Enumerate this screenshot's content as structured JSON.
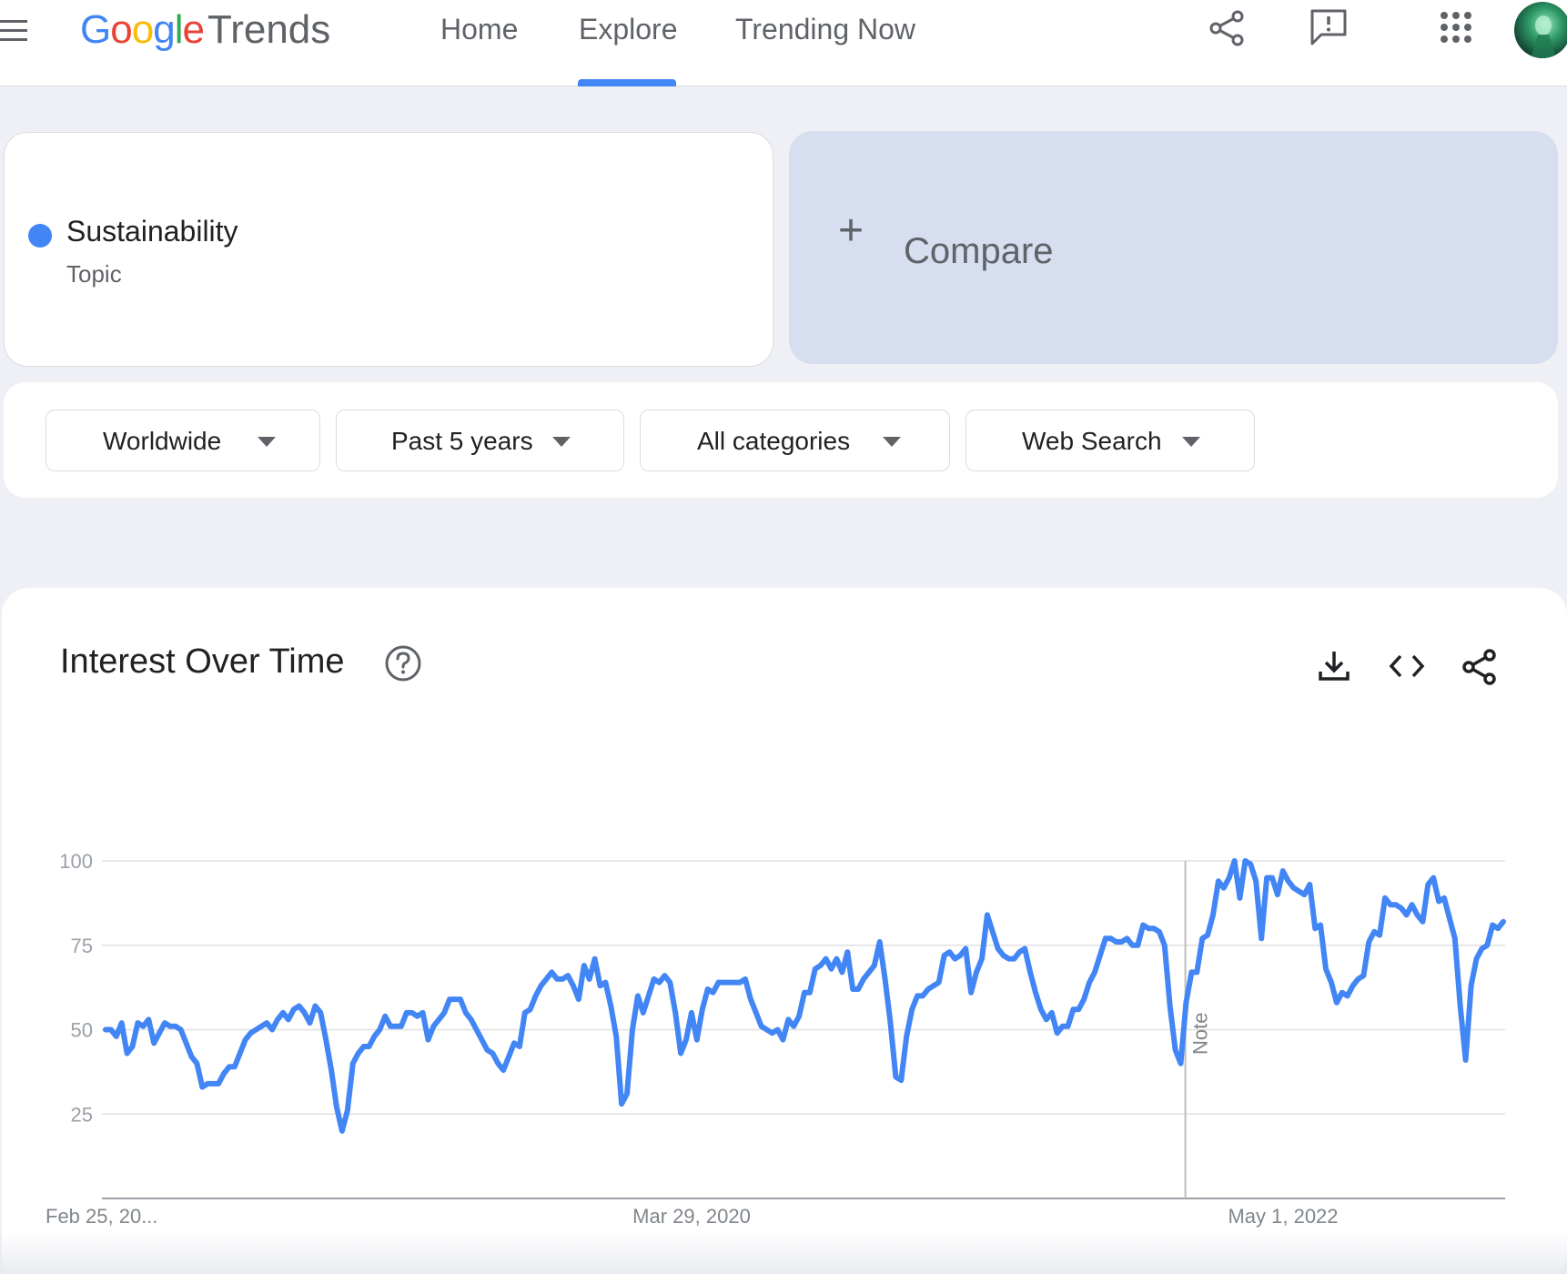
{
  "header": {
    "logo": {
      "g1": "G",
      "o1": "o",
      "o2": "o",
      "g2": "g",
      "l": "l",
      "e": "e",
      "product": "Trends"
    },
    "nav": {
      "home": "Home",
      "explore": "Explore",
      "trending": "Trending Now"
    },
    "active_tab": "Explore",
    "icons": [
      "menu-icon",
      "share-icon",
      "feedback-icon",
      "apps-grid-icon",
      "avatar"
    ]
  },
  "search_term": {
    "name": "Sustainability",
    "type": "Topic",
    "color": "#4285f4"
  },
  "compare": {
    "plus": "+",
    "label": "Compare"
  },
  "filters": {
    "region": "Worldwide",
    "time_range": "Past 5 years",
    "category": "All categories",
    "search_type": "Web Search"
  },
  "chart_card": {
    "title": "Interest Over Time",
    "actions": [
      "download-icon",
      "embed-code-icon",
      "share-icon"
    ],
    "note_label": "Note"
  },
  "chart_data": {
    "type": "line",
    "title": "Interest Over Time",
    "xlabel": "",
    "ylabel": "",
    "ylim": [
      0,
      100
    ],
    "y_ticks": [
      100,
      75,
      50,
      25
    ],
    "x_tick_labels": [
      "Feb 25, 20...",
      "Mar 29, 2020",
      "May 1, 2022"
    ],
    "x_start": "2018-02-25",
    "x_end": "2023-02-19",
    "interval": "weekly",
    "grid": true,
    "annotations": [
      {
        "label": "Note",
        "x": "2022-01-01"
      }
    ],
    "series": [
      {
        "color": "#4285f4",
        "values": [
          50,
          50,
          48,
          52,
          43,
          45,
          52,
          51,
          53,
          46,
          49,
          52,
          51,
          51,
          50,
          46,
          42,
          40,
          33,
          34,
          34,
          34,
          37,
          39,
          39,
          43,
          47,
          49,
          50,
          51,
          52,
          50,
          53,
          55,
          53,
          56,
          57,
          55,
          52,
          57,
          55,
          47,
          38,
          27,
          20,
          26,
          40,
          43,
          45,
          45,
          48,
          50,
          54,
          51,
          51,
          51,
          55,
          55,
          54,
          55,
          47,
          51,
          53,
          55,
          59,
          59,
          59,
          55,
          53,
          50,
          47,
          44,
          43,
          40,
          38,
          42,
          46,
          45,
          55,
          56,
          60,
          63,
          65,
          67,
          65,
          65,
          66,
          63,
          59,
          69,
          65,
          71,
          63,
          64,
          57,
          48,
          28,
          31,
          50,
          60,
          55,
          60,
          65,
          64,
          66,
          64,
          55,
          43,
          47,
          55,
          47,
          56,
          62,
          61,
          64,
          64,
          64,
          64,
          64,
          65,
          59,
          55,
          51,
          50,
          49,
          50,
          47,
          53,
          51,
          54,
          61,
          61,
          68,
          69,
          71,
          68,
          71,
          67,
          73,
          62,
          62,
          65,
          67,
          69,
          76,
          65,
          52,
          36,
          35,
          48,
          56,
          60,
          60,
          62,
          63,
          64,
          72,
          73,
          71,
          72,
          74,
          61,
          67,
          71,
          84,
          79,
          74,
          72,
          71,
          71,
          73,
          74,
          67,
          61,
          56,
          53,
          55,
          49,
          51,
          51,
          56,
          56,
          59,
          64,
          67,
          72,
          77,
          77,
          76,
          76,
          77,
          75,
          75,
          81,
          80,
          80,
          79,
          75,
          57,
          44,
          40,
          58,
          67,
          67,
          77,
          78,
          84,
          94,
          92,
          95,
          100,
          89,
          100,
          99,
          94,
          77,
          95,
          95,
          90,
          97,
          94,
          92,
          91,
          90,
          93,
          80,
          81,
          68,
          64,
          58,
          61,
          60,
          63,
          65,
          66,
          76,
          79,
          78,
          89,
          87,
          87,
          86,
          84,
          87,
          84,
          82,
          93,
          95,
          88,
          89,
          83,
          77,
          57,
          41,
          63,
          71,
          74,
          75,
          81,
          80,
          82
        ]
      }
    ]
  }
}
